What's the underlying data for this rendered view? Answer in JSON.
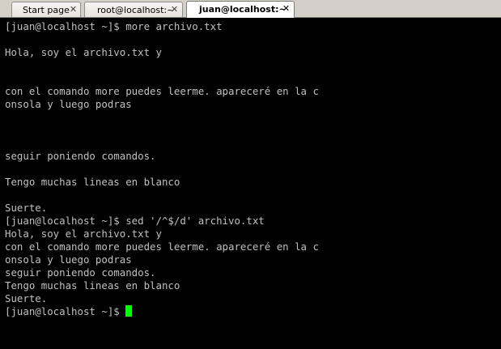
{
  "tabs": [
    {
      "label": "Start page",
      "close_icon": "close-icon",
      "active": false
    },
    {
      "label": "root@localhost:~",
      "close_icon": "close-icon",
      "active": false
    },
    {
      "label": "juan@localhost:~",
      "close_icon": "close-icon",
      "active": true
    }
  ],
  "close_glyph": "✕",
  "colors": {
    "terminal_background": "#000000",
    "terminal_text": "#c0c0c0",
    "cursor": "#00ff00",
    "tabbar_background": "#d4d0c8"
  },
  "terminal": {
    "lines": [
      "[juan@localhost ~]$ more archivo.txt",
      "",
      "Hola, soy el archivo.txt y",
      "",
      "",
      "con el comando more puedes leerme. apareceré en la c",
      "onsola y luego podras",
      "",
      "",
      "",
      "seguir poniendo comandos.",
      "",
      "Tengo muchas lineas en blanco",
      "",
      "Suerte.",
      "[juan@localhost ~]$ sed '/^$/d' archivo.txt",
      "Hola, soy el archivo.txt y",
      "con el comando more puedes leerme. apareceré en la c",
      "onsola y luego podras",
      "seguir poniendo comandos.",
      "Tengo muchas lineas en blanco",
      "Suerte."
    ],
    "prompt": "[juan@localhost ~]$ "
  }
}
